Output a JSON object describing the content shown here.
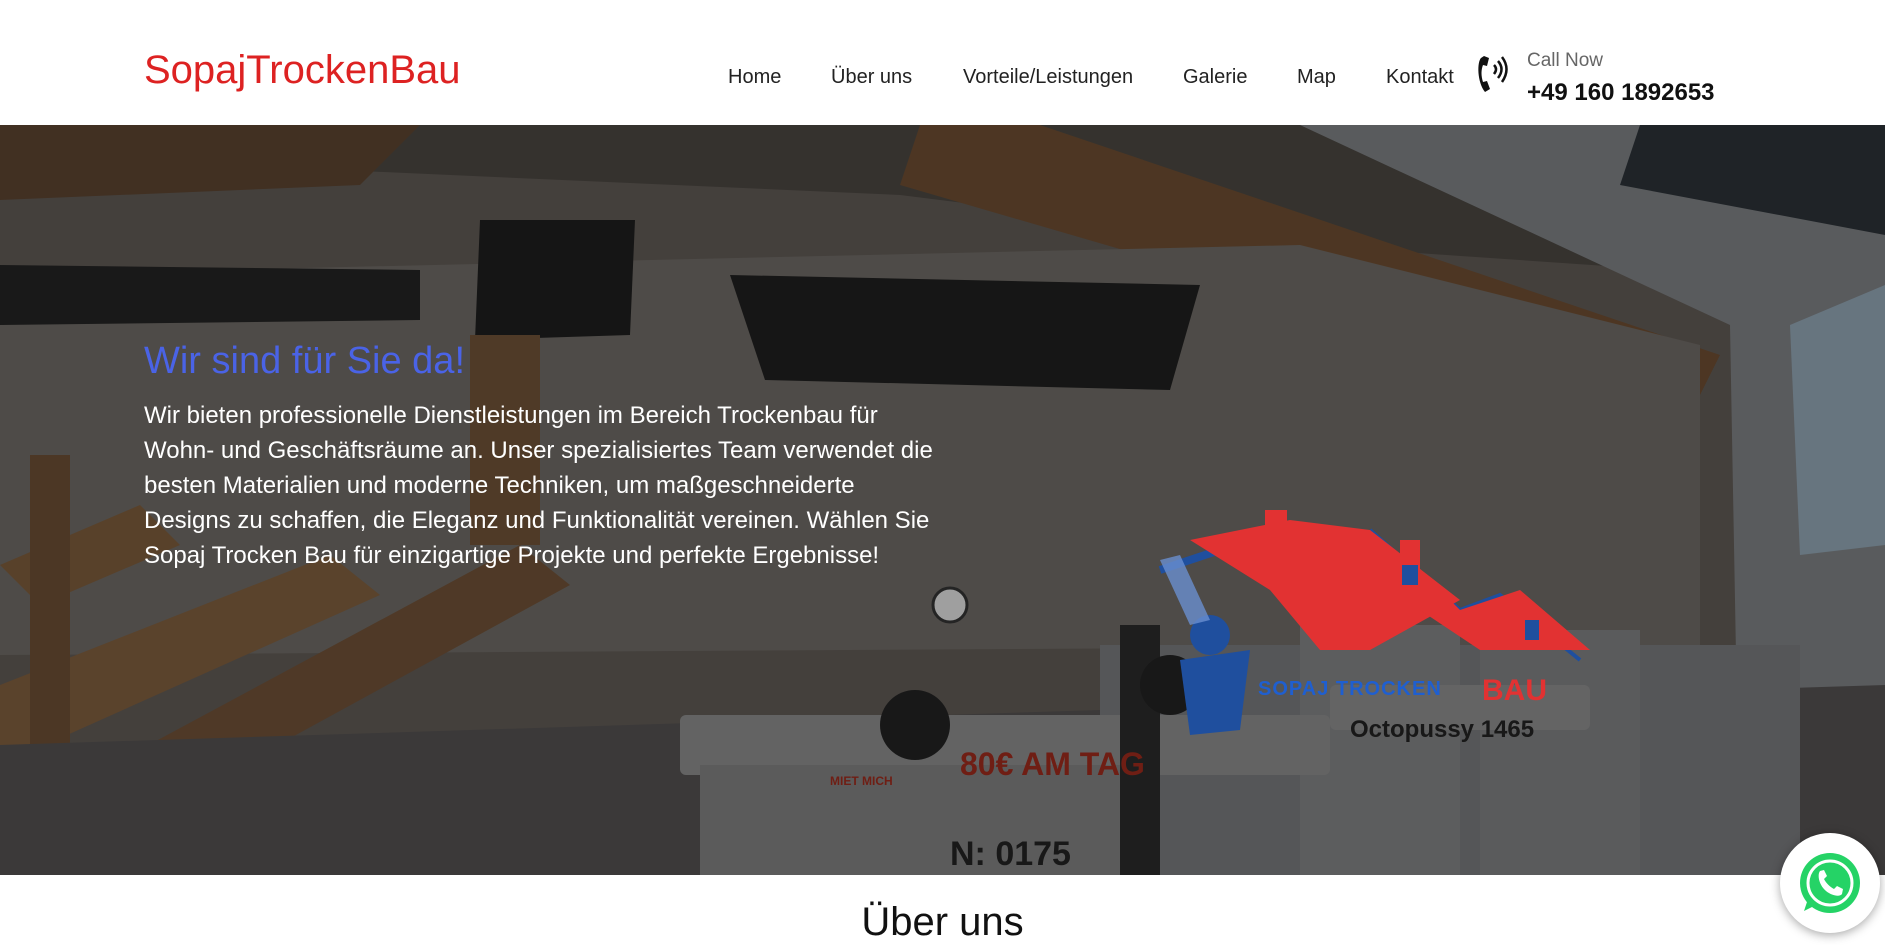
{
  "header": {
    "brand": "SopajTrockenBau",
    "nav": [
      {
        "label": "Home",
        "name": "nav-home"
      },
      {
        "label": "Über uns",
        "name": "nav-ueber-uns"
      },
      {
        "label": "Vorteile/Leistungen",
        "name": "nav-vorteile-leistungen"
      },
      {
        "label": "Galerie",
        "name": "nav-galerie"
      },
      {
        "label": "Map",
        "name": "nav-map"
      },
      {
        "label": "Kontakt",
        "name": "nav-kontakt"
      }
    ],
    "call_label": "Call Now",
    "call_number": "+49 160 1892653"
  },
  "hero": {
    "title": "Wir sind für Sie da!",
    "text": "Wir bieten professionelle Dienstleistungen im Bereich Trockenbau für Wohn- und Geschäftsräume an. Unser spezialisiertes Team verwendet die besten Materialien und moderne Techniken, um maßgeschneiderte Designs zu schaffen, die Eleganz und Funktionalität vereinen. Wählen Sie Sopaj Trocken Bau für einzigartige Projekte und perfekte Ergebnisse!",
    "logo_text_left": "SOPAJ TROCKEN",
    "logo_text_right": "BAU",
    "photo_sign_price": "80€ AM TAG",
    "photo_sign_lift": "Octopussy 1465",
    "photo_sign_miet": "MIET MICH",
    "photo_sign_phone": "N: 0175"
  },
  "section": {
    "title": "Über uns"
  },
  "colors": {
    "brand_red": "#dd2222",
    "hero_title_blue": "#4a63e6",
    "whatsapp_green": "#25d366"
  },
  "icons": {
    "phone": "phone-icon",
    "whatsapp": "whatsapp-icon"
  }
}
